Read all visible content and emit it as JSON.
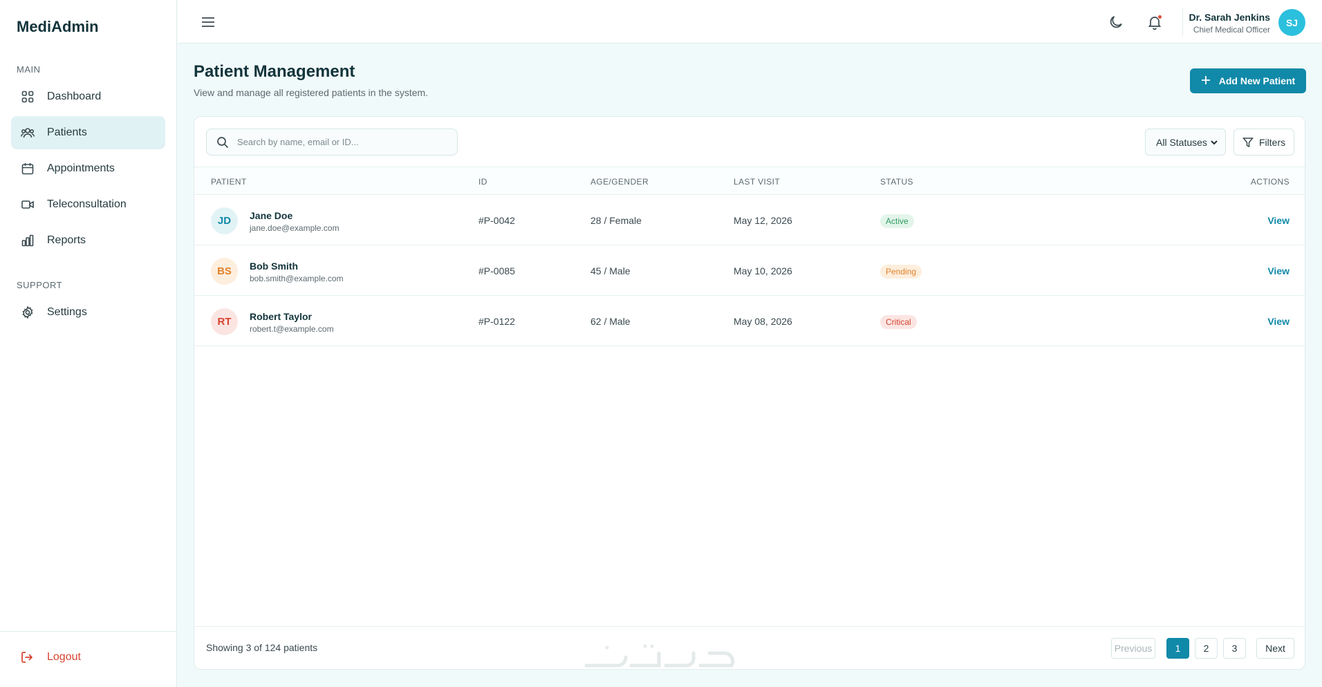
{
  "app": {
    "brand": "MediAdmin"
  },
  "sidebar": {
    "section_main": "MAIN",
    "section_support": "SUPPORT",
    "items": [
      {
        "label": "Dashboard",
        "icon": "grid-icon"
      },
      {
        "label": "Patients",
        "icon": "users-icon",
        "active": true
      },
      {
        "label": "Appointments",
        "icon": "calendar-icon"
      },
      {
        "label": "Teleconsultation",
        "icon": "video-icon"
      },
      {
        "label": "Reports",
        "icon": "bar-chart-icon"
      }
    ],
    "support_items": [
      {
        "label": "Settings",
        "icon": "gear-icon"
      }
    ],
    "logout_label": "Logout"
  },
  "topbar": {
    "user_name": "Dr. Sarah Jenkins",
    "user_role": "Chief Medical Officer",
    "user_initials": "SJ"
  },
  "header": {
    "title": "Patient Management",
    "subtitle": "View and manage all registered patients in the system.",
    "add_button_label": "Add New Patient"
  },
  "toolbar": {
    "search_placeholder": "Search by name, email or ID...",
    "status_select": "All Statuses",
    "filters_label": "Filters"
  },
  "table": {
    "columns": [
      "PATIENT",
      "ID",
      "AGE/GENDER",
      "LAST VISIT",
      "STATUS",
      "ACTIONS"
    ],
    "rows": [
      {
        "initials": "JD",
        "name": "Jane Doe",
        "email": "jane.doe@example.com",
        "id": "#P-0042",
        "age_gender": "28 / Female",
        "last_visit": "May 12, 2026",
        "status": "Active",
        "action": "View"
      },
      {
        "initials": "BS",
        "name": "Bob Smith",
        "email": "bob.smith@example.com",
        "id": "#P-0085",
        "age_gender": "45 / Male",
        "last_visit": "May 10, 2026",
        "status": "Pending",
        "action": "View"
      },
      {
        "initials": "RT",
        "name": "Robert Taylor",
        "email": "robert.t@example.com",
        "id": "#P-0122",
        "age_gender": "62 / Male",
        "last_visit": "May 08, 2026",
        "status": "Critical",
        "action": "View"
      }
    ]
  },
  "pagination": {
    "showing": "Showing 3 of 124 patients",
    "previous": "Previous",
    "pages": [
      "1",
      "2",
      "3"
    ],
    "current_page": "1",
    "next": "Next"
  },
  "colors": {
    "accent": "#1189a8",
    "active_text": "#2f9a62",
    "active_bg": "#e3f5ea",
    "pending_text": "#e0822b",
    "pending_bg": "#fdeedd",
    "critical_text": "#d6432f",
    "critical_bg": "#fbe5e2"
  }
}
